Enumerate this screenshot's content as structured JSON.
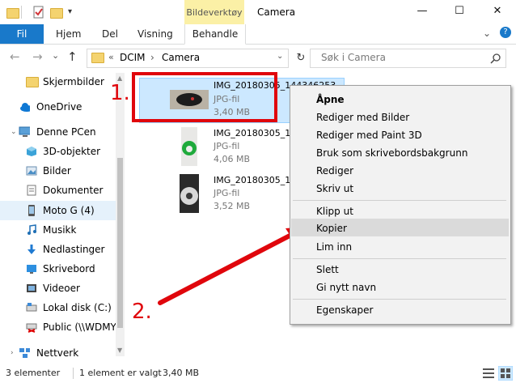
{
  "window": {
    "title": "Camera",
    "contextual_tab_group": "Bildeverktøy",
    "minimize": "—",
    "maximize": "☐",
    "close": "✕"
  },
  "ribbon": {
    "tabs": [
      "Fil",
      "Hjem",
      "Del",
      "Visning",
      "Behandle"
    ],
    "expand": "⌄",
    "help": "?"
  },
  "address": {
    "back": "←",
    "forward": "→",
    "recent": "⌄",
    "up": "↑",
    "overflow": "«",
    "path": [
      "DCIM",
      "Camera"
    ],
    "separator": "›",
    "refresh": "↻",
    "search_placeholder": "Søk i Camera"
  },
  "sidebar": {
    "items": [
      {
        "label": "Skjermbilder",
        "icon": "folder-icon"
      },
      {
        "label": "OneDrive",
        "icon": "onedrive-icon"
      },
      {
        "label": "Denne PCen",
        "icon": "pc-icon"
      },
      {
        "label": "3D-objekter",
        "icon": "3d-objects-icon"
      },
      {
        "label": "Bilder",
        "icon": "pictures-icon"
      },
      {
        "label": "Dokumenter",
        "icon": "documents-icon"
      },
      {
        "label": "Moto G (4)",
        "icon": "phone-icon"
      },
      {
        "label": "Musikk",
        "icon": "music-icon"
      },
      {
        "label": "Nedlastinger",
        "icon": "downloads-icon"
      },
      {
        "label": "Skrivebord",
        "icon": "desktop-icon"
      },
      {
        "label": "Videoer",
        "icon": "videos-icon"
      },
      {
        "label": "Lokal disk (C:)",
        "icon": "disk-icon"
      },
      {
        "label": "Public (\\\\WDMY",
        "icon": "network-drive-icon"
      },
      {
        "label": "Nettverk",
        "icon": "network-icon"
      }
    ],
    "selected": "Moto G (4)"
  },
  "files": [
    {
      "name": "IMG_20180305_144346253",
      "type": "JPG-fil",
      "size": "3,40 MB",
      "selected": true
    },
    {
      "name": "IMG_20180305_14",
      "type": "JPG-fil",
      "size": "4,06 MB",
      "selected": false
    },
    {
      "name": "IMG_20180305_14",
      "type": "JPG-fil",
      "size": "3,52 MB",
      "selected": false
    }
  ],
  "context_menu": {
    "items": [
      "Åpne",
      "Rediger med Bilder",
      "Rediger med Paint 3D",
      "Bruk som skrivebordsbakgrunn",
      "Rediger",
      "Skriv ut",
      "Klipp ut",
      "Kopier",
      "Lim inn",
      "Slett",
      "Gi nytt navn",
      "Egenskaper"
    ],
    "highlighted": "Kopier"
  },
  "annotations": {
    "step1": "1.",
    "step2": "2.",
    "color": "#e0060c"
  },
  "status": {
    "count": "3 elementer",
    "selection": "1 element er valgt",
    "size": "3,40 MB"
  }
}
